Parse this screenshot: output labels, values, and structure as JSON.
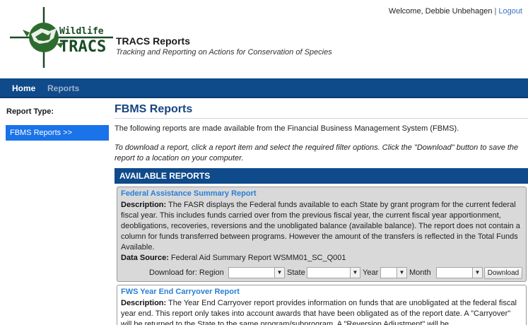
{
  "header": {
    "logo_word1": "Wildlife",
    "logo_word2": "TRACS",
    "title": "TRACS Reports",
    "subtitle": "Tracking and Reporting on Actions for Conservation of Species",
    "welcome_text": "Welcome, Debbie Unbehagen",
    "separator": "|",
    "logout_label": "Logout"
  },
  "nav": {
    "home_label": "Home",
    "reports_label": "Reports"
  },
  "sidebar": {
    "label": "Report Type:",
    "items": [
      {
        "label": "FBMS Reports  >>"
      }
    ]
  },
  "main": {
    "title": "FBMS Reports",
    "intro": "The following reports are made available from the Financial Business Management System (FBMS).",
    "instructions": "To download a report, click a report item and select the required filter options. Click the \"Download\" button to save the report to a location on your computer.",
    "available_header": "AVAILABLE REPORTS",
    "reports": [
      {
        "name": "Federal Assistance Summary Report",
        "desc_label": "Description:",
        "description": "The FASR displays the Federal funds available to each State by grant program for the current federal fiscal year. This includes funds carried over from the previous fiscal year, the current fiscal year apportionment, deobligations, recoveries, reversions and the unobligated balance (available balance). The report does not contain a column for funds transferred between programs. However the amount of the transfers is reflected in the Total Funds Available.",
        "source_label": "Data Source:",
        "source": "Federal Aid Summary Report WSMM01_SC_Q001",
        "filters": {
          "download_for": "Download for: Region",
          "state": "State",
          "year": "Year",
          "month": "Month",
          "download_button": "Download"
        }
      },
      {
        "name": "FWS Year End Carryover Report",
        "desc_label": "Description:",
        "description": "The Year End Carryover report provides information on funds that are unobligated at the federal fiscal year end. This report only takes into account awards that have been obligated as of the report date. A \"Carryover\" will be returned to the State to the same program/subprogram. A \"Reversion Adjustment\" will be"
      }
    ]
  }
}
